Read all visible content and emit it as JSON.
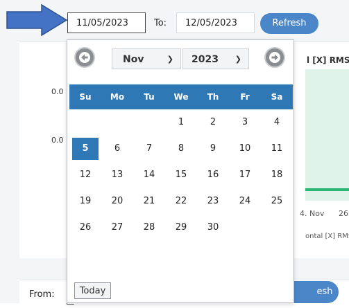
{
  "filters": {
    "from_value": "11/05/2023",
    "to_label": "To:",
    "to_value": "12/05/2023",
    "refresh_label": "Refresh"
  },
  "datepicker": {
    "month": "Nov",
    "year": "2023",
    "weekdays": [
      "Su",
      "Mo",
      "Tu",
      "We",
      "Th",
      "Fr",
      "Sa"
    ],
    "leading_blanks": 3,
    "days": [
      "1",
      "2",
      "3",
      "4",
      "5",
      "6",
      "7",
      "8",
      "9",
      "10",
      "11",
      "12",
      "13",
      "14",
      "15",
      "16",
      "17",
      "18",
      "19",
      "20",
      "21",
      "22",
      "23",
      "24",
      "25",
      "26",
      "27",
      "28",
      "29",
      "30"
    ],
    "selected_day": "5",
    "today_label": "Today"
  },
  "background": {
    "chart_title": "l [X] RMS T",
    "y_ticks": [
      "0.0",
      "0.0"
    ],
    "x_ticks": [
      "4. Nov",
      "26"
    ],
    "legend": "ontal [X] RMS",
    "from_label": "From:",
    "refresh_partial": "esh"
  },
  "colors": {
    "accent": "#2f78b6",
    "button": "#4a86c8",
    "arrow": "#4472c4"
  }
}
